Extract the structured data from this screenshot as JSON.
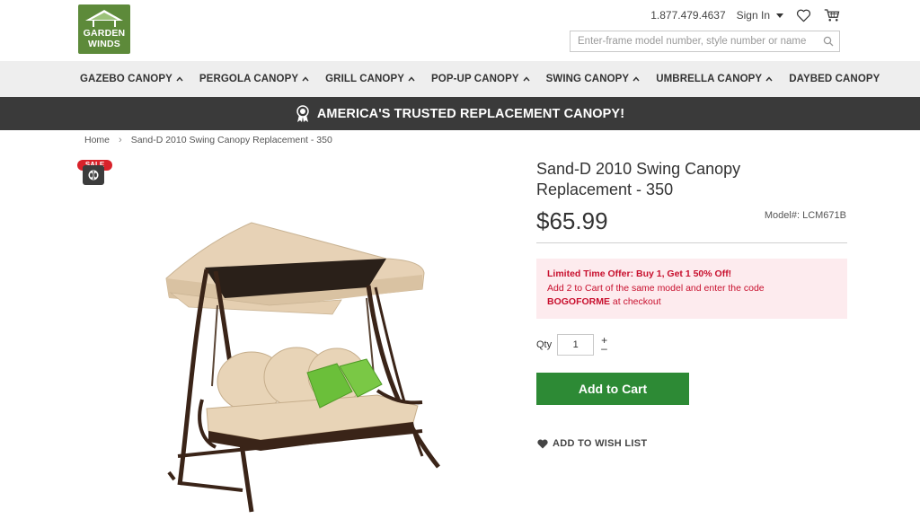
{
  "brand": {
    "logo_line1": "GARDEN",
    "logo_line2": "WINDS",
    "green": "#5d8a3a"
  },
  "header": {
    "phone": "1.877.479.4637",
    "signin_label": "Sign In",
    "wishlist_icon": "heart-icon",
    "cart_icon": "cart-icon",
    "search_placeholder": "Enter-frame model number, style number or name"
  },
  "nav": {
    "items": [
      {
        "label": "GAZEBO CANOPY",
        "has_dropdown": true
      },
      {
        "label": "PERGOLA CANOPY",
        "has_dropdown": true
      },
      {
        "label": "GRILL CANOPY",
        "has_dropdown": true
      },
      {
        "label": "POP-UP CANOPY",
        "has_dropdown": true
      },
      {
        "label": "SWING CANOPY",
        "has_dropdown": true
      },
      {
        "label": "UMBRELLA CANOPY",
        "has_dropdown": true
      },
      {
        "label": "DAYBED CANOPY",
        "has_dropdown": false
      }
    ]
  },
  "banner": {
    "text": "AMERICA'S TRUSTED REPLACEMENT CANOPY!",
    "icon": "award-ribbon-icon"
  },
  "breadcrumb": {
    "home": "Home",
    "current": "Sand-D 2010 Swing Canopy Replacement - 350"
  },
  "product": {
    "badge": "SALE",
    "title": "Sand-D 2010 Swing Canopy Replacement - 350",
    "price": "$65.99",
    "model_label": "Model#:",
    "model_value": "LCM671B",
    "offer": {
      "headline": "Limited Time Offer: Buy 1, Get 1 50% Off!",
      "line2": "Add 2 to Cart of the same model and enter the code",
      "code": "BOGOFORME",
      "line3_suffix": " at checkout"
    },
    "qty_label": "Qty",
    "qty_value": "1",
    "add_to_cart": "Add to Cart",
    "wishlist_label": "ADD TO WISH LIST"
  },
  "colors": {
    "nav_bg": "#eeeeee",
    "banner_bg": "#3a3a3a",
    "button_green": "#2d8a35",
    "offer_bg": "#fdebee",
    "offer_red": "#c8102e"
  }
}
